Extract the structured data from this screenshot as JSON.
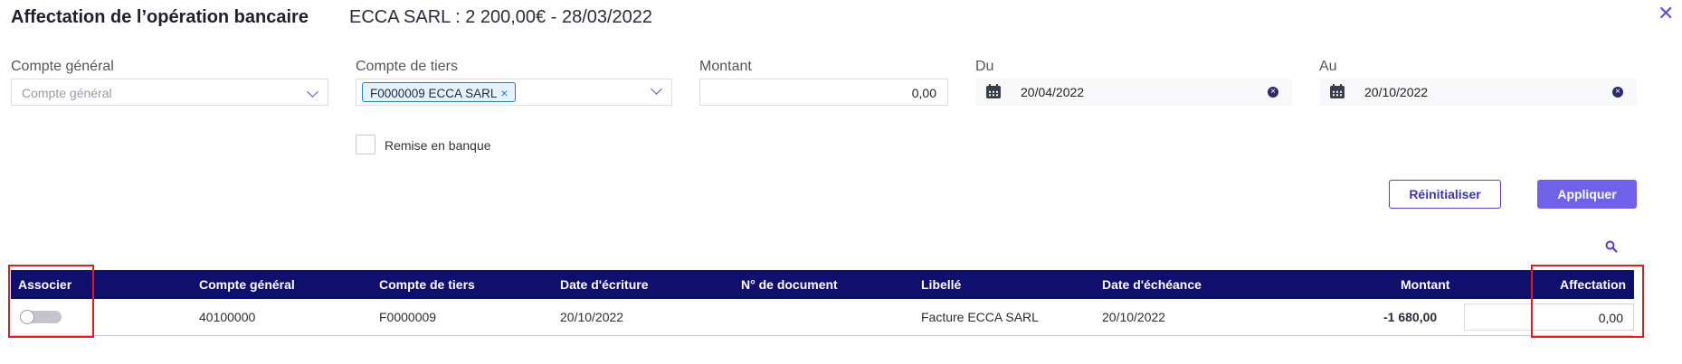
{
  "header": {
    "title": "Affectation de l’opération bancaire",
    "subtitle": "ECCA SARL : 2 200,00€ - 28/03/2022",
    "close_glyph": "✕"
  },
  "filters": {
    "compte_general": {
      "label": "Compte général",
      "placeholder": "Compte général"
    },
    "compte_tiers": {
      "label": "Compte de tiers",
      "tag": "F0000009 ECCA SARL",
      "tag_remove": "×"
    },
    "montant": {
      "label": "Montant",
      "value": "0,00"
    },
    "du": {
      "label": "Du",
      "value": "20/04/2022",
      "icon": "calendar-icon"
    },
    "au": {
      "label": "Au",
      "value": "20/10/2022",
      "icon": "calendar-icon"
    },
    "remise": {
      "label": "Remise en banque",
      "checked": false
    }
  },
  "actions": {
    "reset_label": "Réinitialiser",
    "apply_label": "Appliquer",
    "search_icon": "search-icon"
  },
  "table": {
    "columns": [
      "Associer",
      "Compte général",
      "Compte de tiers",
      "Date d'écriture",
      "N° de document",
      "Libellé",
      "Date d'échéance",
      "Montant",
      "Affectation"
    ],
    "rows": [
      {
        "associer": false,
        "compte_general": "40100000",
        "compte_tiers": "F0000009",
        "date_ecriture": "20/10/2022",
        "numero_document": "",
        "libelle": "Facture ECCA SARL",
        "date_echeance": "20/10/2022",
        "montant": "-1 680,00",
        "affectation": "0,00"
      }
    ]
  },
  "colors": {
    "accent": "#6f62e8",
    "table_header": "#0f0f6e",
    "highlight": "#e01b1b",
    "tag_border": "#1f7fcc"
  }
}
